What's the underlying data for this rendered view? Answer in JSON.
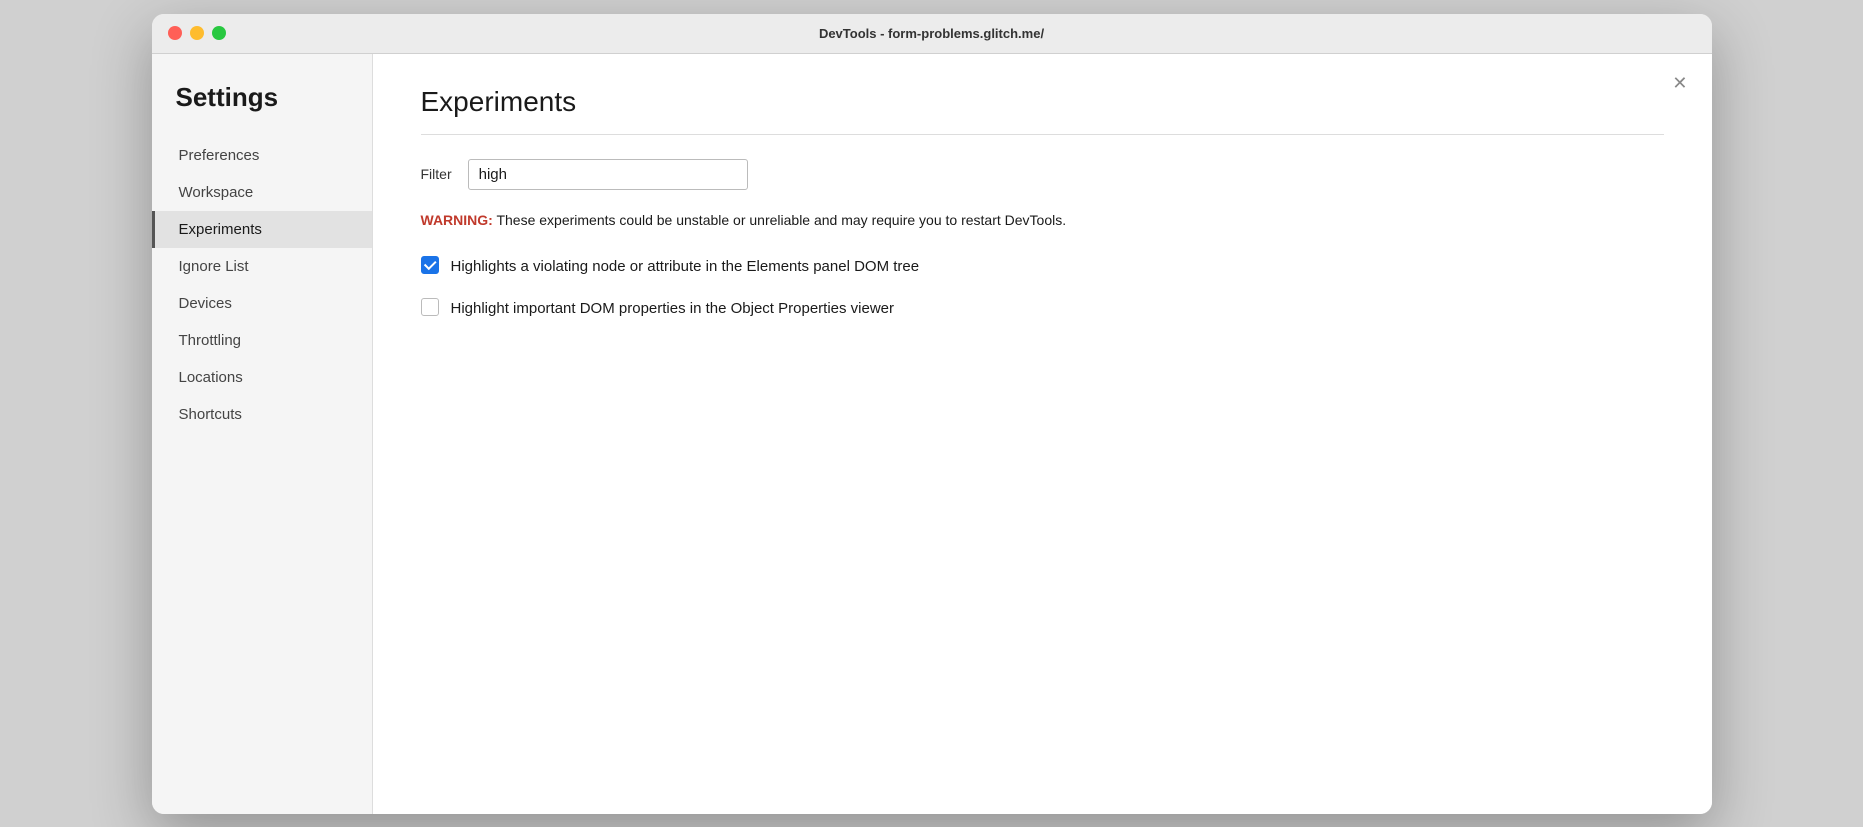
{
  "window": {
    "title": "DevTools - form-problems.glitch.me/"
  },
  "sidebar": {
    "heading": "Settings",
    "items": [
      {
        "id": "preferences",
        "label": "Preferences",
        "active": false
      },
      {
        "id": "workspace",
        "label": "Workspace",
        "active": false
      },
      {
        "id": "experiments",
        "label": "Experiments",
        "active": true
      },
      {
        "id": "ignore-list",
        "label": "Ignore List",
        "active": false
      },
      {
        "id": "devices",
        "label": "Devices",
        "active": false
      },
      {
        "id": "throttling",
        "label": "Throttling",
        "active": false
      },
      {
        "id": "locations",
        "label": "Locations",
        "active": false
      },
      {
        "id": "shortcuts",
        "label": "Shortcuts",
        "active": false
      }
    ]
  },
  "main": {
    "title": "Experiments",
    "close_label": "✕",
    "filter": {
      "label": "Filter",
      "value": "high",
      "placeholder": ""
    },
    "warning": {
      "prefix": "WARNING:",
      "text": " These experiments could be unstable or unreliable and may require you to restart DevTools."
    },
    "experiments": [
      {
        "id": "exp1",
        "label": "Highlights a violating node or attribute in the Elements panel DOM tree",
        "checked": true
      },
      {
        "id": "exp2",
        "label": "Highlight important DOM properties in the Object Properties viewer",
        "checked": false
      }
    ]
  },
  "traffic_lights": {
    "close_color": "#ff5f57",
    "minimize_color": "#febc2e",
    "maximize_color": "#28c840"
  }
}
